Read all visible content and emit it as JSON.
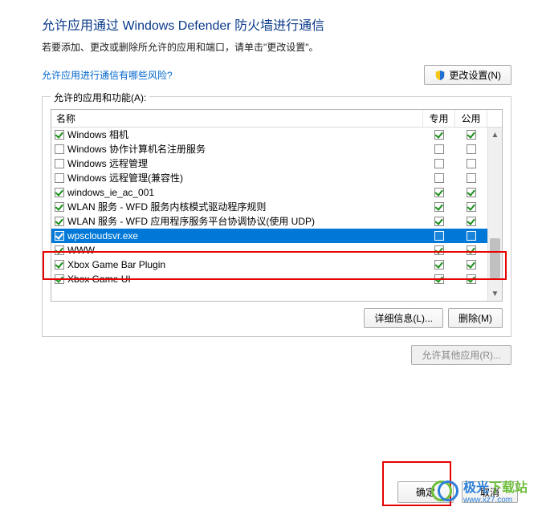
{
  "title": "允许应用通过 Windows Defender 防火墙进行通信",
  "subtitle": "若要添加、更改或删除所允许的应用和端口，请单击\"更改设置\"。",
  "riskLink": "允许应用进行通信有哪些风险?",
  "changeSettingsBtn": "更改设置(N)",
  "groupLabel": "允许的应用和功能(A):",
  "cols": {
    "name": "名称",
    "private": "专用",
    "public": "公用"
  },
  "rows": [
    {
      "name": "Windows 相机",
      "c0": true,
      "c1": true,
      "c2": true,
      "sel": false
    },
    {
      "name": "Windows 协作计算机名注册服务",
      "c0": false,
      "c1": false,
      "c2": false,
      "sel": false
    },
    {
      "name": "Windows 远程管理",
      "c0": false,
      "c1": false,
      "c2": false,
      "sel": false
    },
    {
      "name": "Windows 远程管理(兼容性)",
      "c0": false,
      "c1": false,
      "c2": false,
      "sel": false
    },
    {
      "name": "windows_ie_ac_001",
      "c0": true,
      "c1": true,
      "c2": true,
      "sel": false
    },
    {
      "name": "WLAN 服务 - WFD 服务内核模式驱动程序规则",
      "c0": true,
      "c1": true,
      "c2": true,
      "sel": false
    },
    {
      "name": "WLAN 服务 - WFD 应用程序服务平台协调协议(使用 UDP)",
      "c0": true,
      "c1": true,
      "c2": true,
      "sel": false
    },
    {
      "name": "wpscloudsvr.exe",
      "c0": true,
      "c1": false,
      "c2": false,
      "sel": true
    },
    {
      "name": "WWW",
      "c0": true,
      "c1": true,
      "c2": true,
      "sel": false
    },
    {
      "name": "Xbox Game Bar Plugin",
      "c0": true,
      "c1": true,
      "c2": true,
      "sel": false
    },
    {
      "name": "Xbox Game UI",
      "c0": true,
      "c1": true,
      "c2": true,
      "sel": false
    }
  ],
  "detailsBtn": "详细信息(L)...",
  "removeBtn": "删除(M)",
  "allowOtherBtn": "允许其他应用(R)...",
  "okBtn": "确定",
  "cancelBtn": "取消",
  "watermark": {
    "brand1": "极光",
    "brand2": "下载站",
    "url": "www.xz7.com"
  }
}
